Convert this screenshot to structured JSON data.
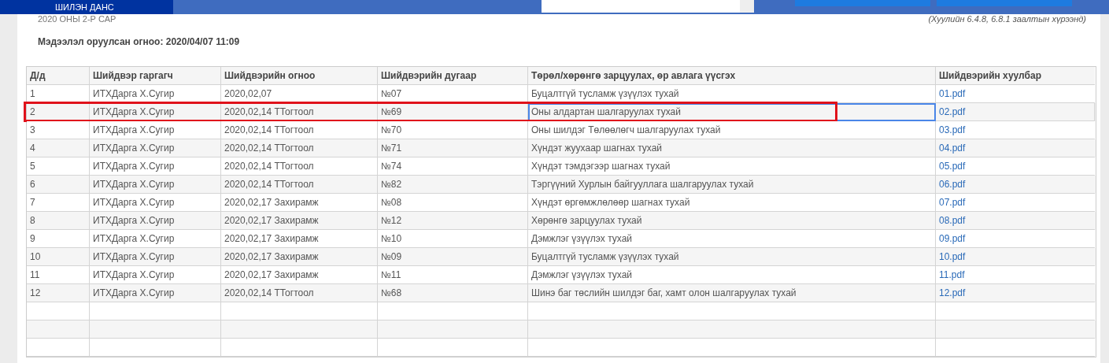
{
  "header": {
    "tab": "ШИЛЭН ДАНС",
    "legal_note": "(Хуулийн 6.4.8, 6.8.1 заалтын хүрээнд)"
  },
  "period": "2020 ОНЫ 2-Р САР",
  "entry_date": "Мэдээлэл оруулсан огноо: 2020/04/07 11:09",
  "table": {
    "columns": [
      "Д/д",
      "Шийдвэр гаргагч",
      "Шийдвэрийн огноо",
      "Шийдвэрийн дугаар",
      "Төрөл/хөрөнгө зарцуулах, өр авлага үүсгэх",
      "Шийдвэрийн хуулбар"
    ],
    "rows": [
      {
        "cells": [
          "1",
          "ИТХДарга Х.Сугир",
          "2020,02,07",
          "№07",
          "Буцалтгүй тусламж үзүүлэх тухай",
          "01.pdf"
        ],
        "annotated": false,
        "description_selected": false
      },
      {
        "cells": [
          "2",
          "ИТХДарга Х.Сугир",
          "2020,02,14 ТТогтоол",
          "№69",
          "Оны алдартан шалгаруулах тухай",
          "02.pdf"
        ],
        "annotated": true,
        "description_selected": true
      },
      {
        "cells": [
          "3",
          "ИТХДарга Х.Сугир",
          "2020,02,14 ТТогтоол",
          "№70",
          "Оны шилдэг Төлөөлөгч шалгаруулах тухай",
          "03.pdf"
        ],
        "annotated": false,
        "description_selected": false
      },
      {
        "cells": [
          "4",
          "ИТХДарга Х.Сугир",
          "2020,02,14 ТТогтоол",
          "№71",
          "Хүндэт жуухаар шагнах тухай",
          "04.pdf"
        ],
        "annotated": false,
        "description_selected": false
      },
      {
        "cells": [
          "5",
          "ИТХДарга Х.Сугир",
          "2020,02,14 ТТогтоол",
          "№74",
          "Хүндэт тэмдэгээр шагнах тухай",
          "05.pdf"
        ],
        "annotated": false,
        "description_selected": false
      },
      {
        "cells": [
          "6",
          "ИТХДарга Х.Сугир",
          "2020,02,14 ТТогтоол",
          "№82",
          "Тэргүүний Хурлын байгууллага шалгаруулах тухай",
          "06.pdf"
        ],
        "annotated": false,
        "description_selected": false
      },
      {
        "cells": [
          "7",
          "ИТХДарга Х.Сугир",
          "2020,02,17 Захирамж",
          "№08",
          "Хүндэт өргөмжлөлөөр шагнах тухай",
          "07.pdf"
        ],
        "annotated": false,
        "description_selected": false
      },
      {
        "cells": [
          "8",
          "ИТХДарга Х.Сугир",
          "2020,02,17 Захирамж",
          "№12",
          "Хөрөнгө зарцуулах тухай",
          "08.pdf"
        ],
        "annotated": false,
        "description_selected": false
      },
      {
        "cells": [
          "9",
          "ИТХДарга Х.Сугир",
          "2020,02,17 Захирамж",
          "№10",
          "Дэмжлэг үзүүлэх тухай",
          "09.pdf"
        ],
        "annotated": false,
        "description_selected": false
      },
      {
        "cells": [
          "10",
          "ИТХДарга Х.Сугир",
          "2020,02,17 Захирамж",
          "№09",
          "Буцалтгүй тусламж үзүүлэх тухай",
          "10.pdf"
        ],
        "annotated": false,
        "description_selected": false
      },
      {
        "cells": [
          "11",
          "ИТХДарга Х.Сугир",
          "2020,02,17 Захирамж",
          "№11",
          "Дэмжлэг үзүүлэх тухай",
          "11.pdf"
        ],
        "annotated": false,
        "description_selected": false
      },
      {
        "cells": [
          "12",
          "ИТХДарга Х.Сугир",
          "2020,02,14 ТТогтоол",
          "№68",
          "Шинэ баг төслийн шилдэг баг, хамт олон шалгаруулах тухай",
          "12.pdf"
        ],
        "annotated": false,
        "description_selected": false
      }
    ]
  }
}
